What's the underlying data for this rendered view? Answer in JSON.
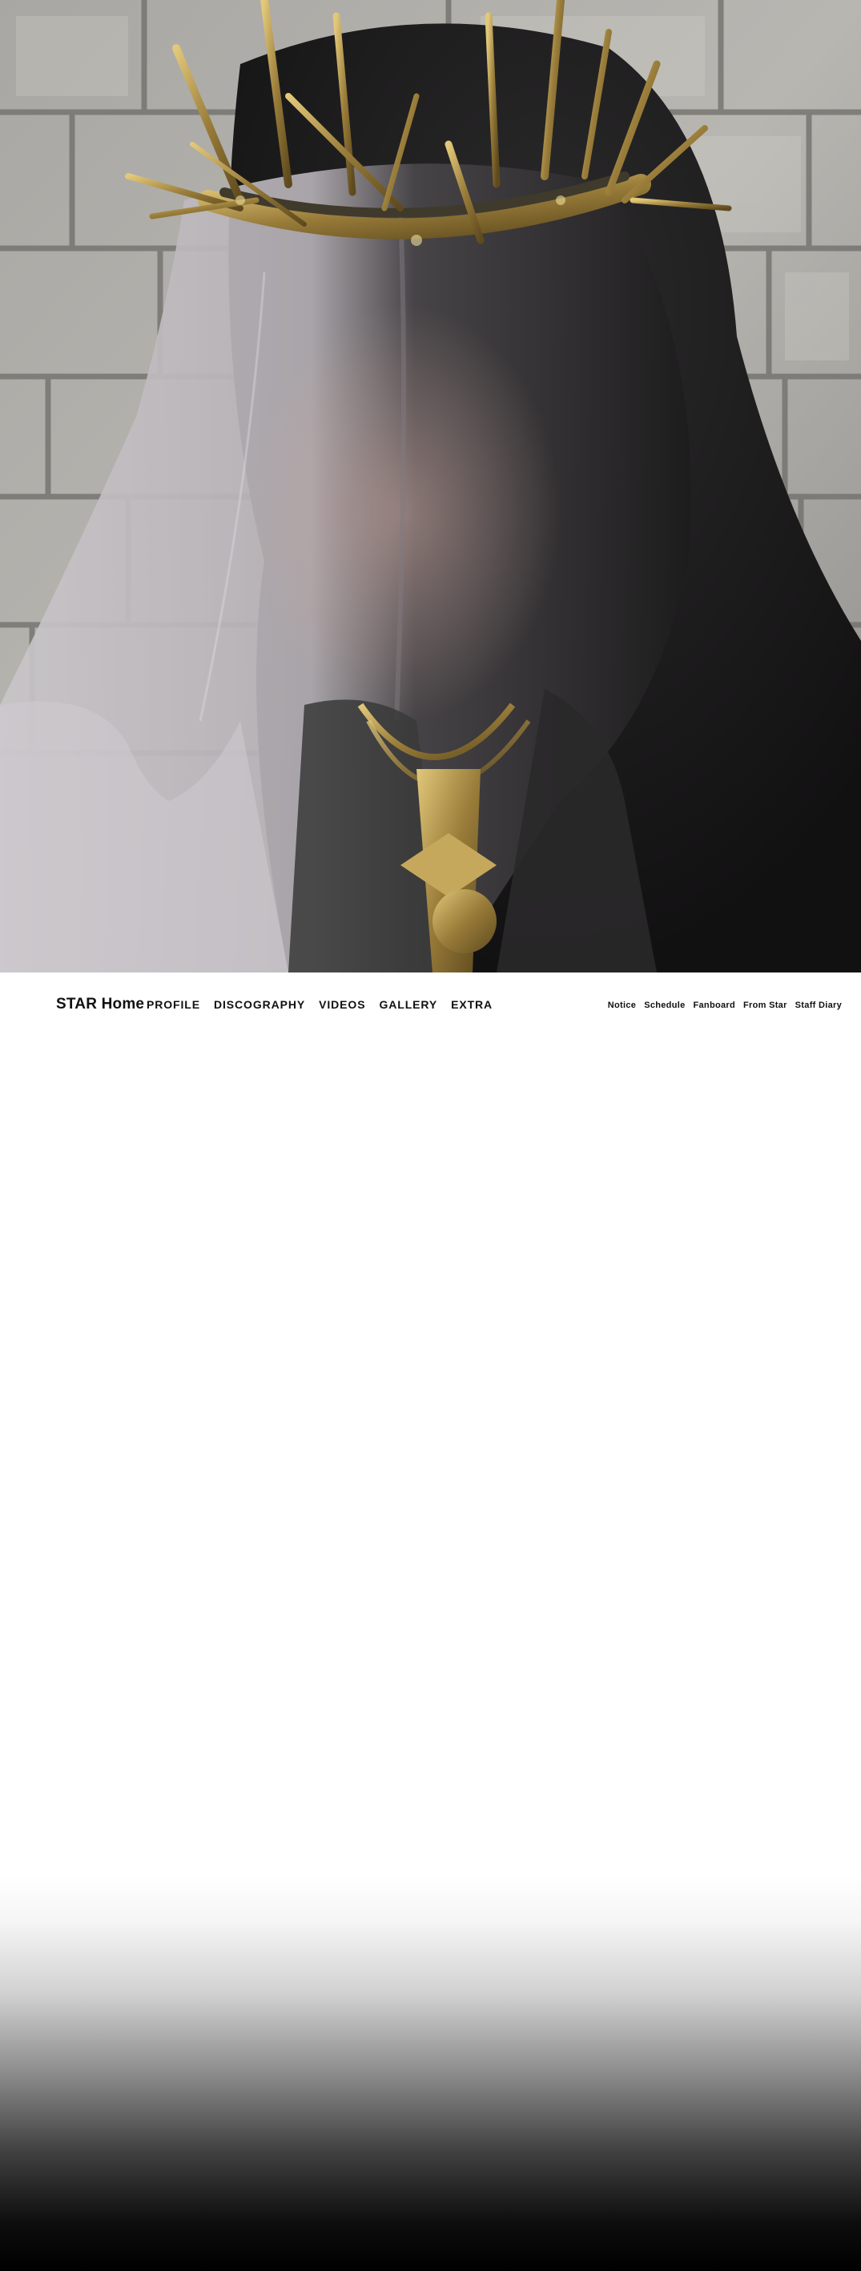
{
  "hero": {
    "image": "veiled-figure-crown-of-thorns-photo"
  },
  "nav": {
    "brand": "STAR Home",
    "main_menu": [
      "PROFILE",
      "DISCOGRAPHY",
      "VIDEOS",
      "GALLERY",
      "EXTRA"
    ],
    "sub_menu": [
      "Notice",
      "Schedule",
      "Fanboard",
      "From Star",
      "Staff Diary"
    ]
  },
  "colors": {
    "background": "#ffffff",
    "text": "#111111",
    "footer_fade": "#000000",
    "gold": "#b59a52"
  }
}
